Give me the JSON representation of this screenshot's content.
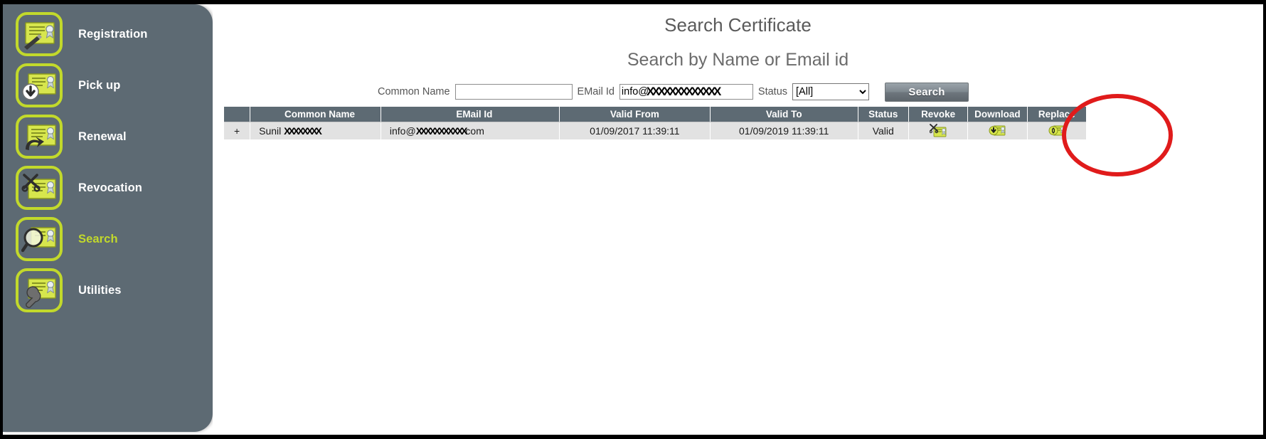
{
  "sidebar": {
    "items": [
      {
        "label": "Registration",
        "icon": "certificate-pen-icon",
        "active": false
      },
      {
        "label": "Pick up",
        "icon": "certificate-download-icon",
        "active": false
      },
      {
        "label": "Renewal",
        "icon": "certificate-renew-arrow-icon",
        "active": false
      },
      {
        "label": "Revocation",
        "icon": "certificate-revoke-icon",
        "active": false
      },
      {
        "label": "Search",
        "icon": "certificate-magnifier-icon",
        "active": true
      },
      {
        "label": "Utilities",
        "icon": "certificate-wrench-icon",
        "active": false
      }
    ]
  },
  "header": {
    "title": "Search Certificate",
    "subtitle": "Search by Name or Email id"
  },
  "search_form": {
    "common_name_label": "Common Name",
    "common_name_value": "",
    "common_name_placeholder": "",
    "email_label": "EMail Id",
    "email_value": "info@",
    "email_redacted_mask": "XXXXXXXXXXXXX",
    "status_label": "Status",
    "status_selected": "[All]",
    "status_options": [
      "[All]"
    ],
    "search_button_label": "Search"
  },
  "table": {
    "columns": [
      {
        "key": "expander",
        "label": ""
      },
      {
        "key": "common_name",
        "label": "Common Name"
      },
      {
        "key": "email",
        "label": "EMail Id"
      },
      {
        "key": "valid_from",
        "label": "Valid From"
      },
      {
        "key": "valid_to",
        "label": "Valid To"
      },
      {
        "key": "status",
        "label": "Status"
      },
      {
        "key": "revoke",
        "label": "Revoke"
      },
      {
        "key": "download",
        "label": "Download"
      },
      {
        "key": "replace",
        "label": "Replace"
      }
    ],
    "rows": [
      {
        "expander": "+",
        "common_name_visible": "Sunil ",
        "common_name_redacted": "XXXXXXXX",
        "email_prefix": "info@",
        "email_redacted": "XXXXXXXXXXX",
        "email_suffix": "com",
        "valid_from": "01/09/2017 11:39:11",
        "valid_to": "01/09/2019 11:39:11",
        "status": "Valid",
        "revoke_icon": "certificate-revoke-icon",
        "download_icon": "certificate-download-icon",
        "replace_icon": "certificate-replace-icon"
      }
    ]
  },
  "annotation": {
    "shape": "ellipse",
    "color": "#e01b1b",
    "targets": "Download column"
  },
  "colors": {
    "sidebar_bg": "#5d6a73",
    "accent_green": "#c2d92b",
    "table_header_bg": "#5d6a73",
    "row_bg": "#e2e2e2",
    "status_valid": "#4d7d52",
    "annotation_red": "#e01b1b"
  }
}
